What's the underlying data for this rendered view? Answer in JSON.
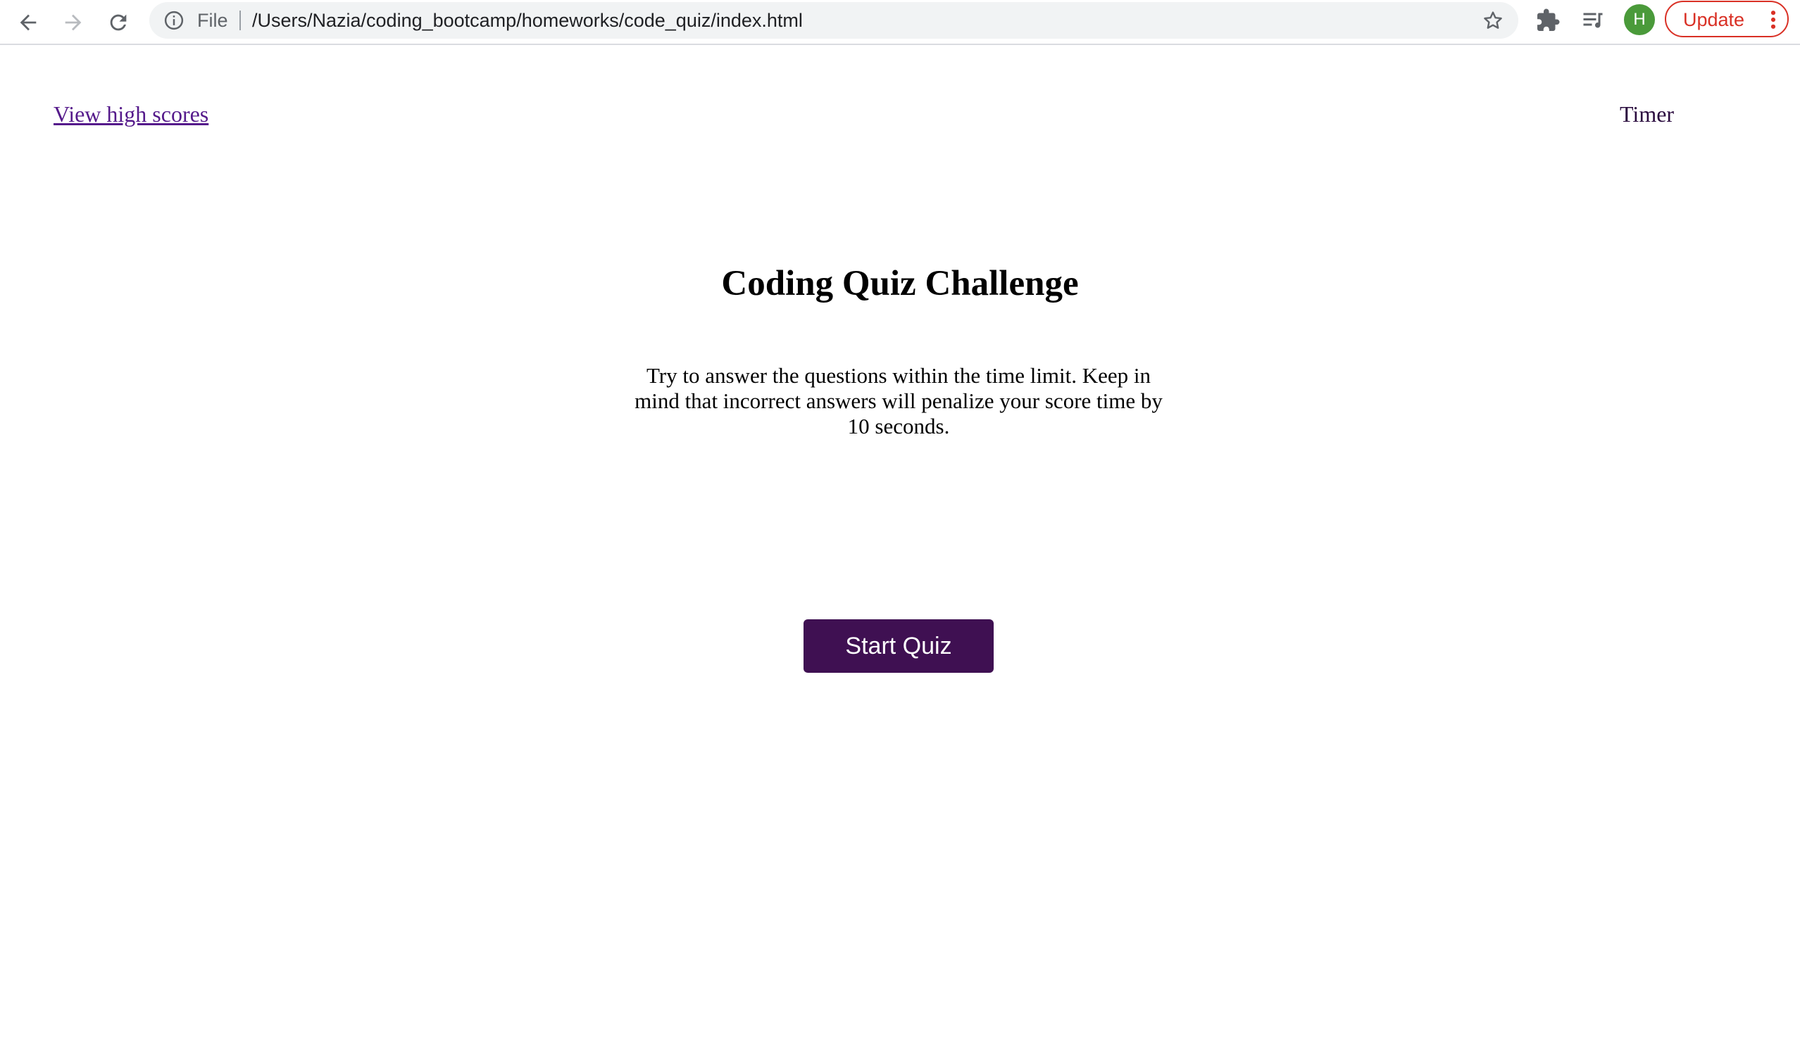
{
  "browser": {
    "url_scheme_label": "File",
    "url": "/Users/Nazia/coding_bootcamp/homeworks/code_quiz/index.html",
    "profile_initial": "H",
    "update_label": "Update",
    "icons": {
      "back": "back-arrow-icon",
      "forward": "forward-arrow-icon",
      "reload": "reload-icon",
      "info": "info-icon",
      "bookmark": "star-icon",
      "extensions": "puzzle-icon",
      "media": "media-queue-icon",
      "menu": "kebab-menu-icon"
    },
    "colors": {
      "update_accent": "#d93025",
      "avatar_bg": "#4a9a3a"
    }
  },
  "page": {
    "highscores_link": "View high scores",
    "timer_label": "Timer",
    "title": "Coding Quiz Challenge",
    "intro": "Try to answer the questions within the time limit. Keep in mind that incorrect answers will penalize your score time by 10 seconds.",
    "start_button": "Start Quiz",
    "colors": {
      "link": "#551a8b",
      "button_bg": "#3f1052",
      "button_text": "#ffffff"
    }
  }
}
